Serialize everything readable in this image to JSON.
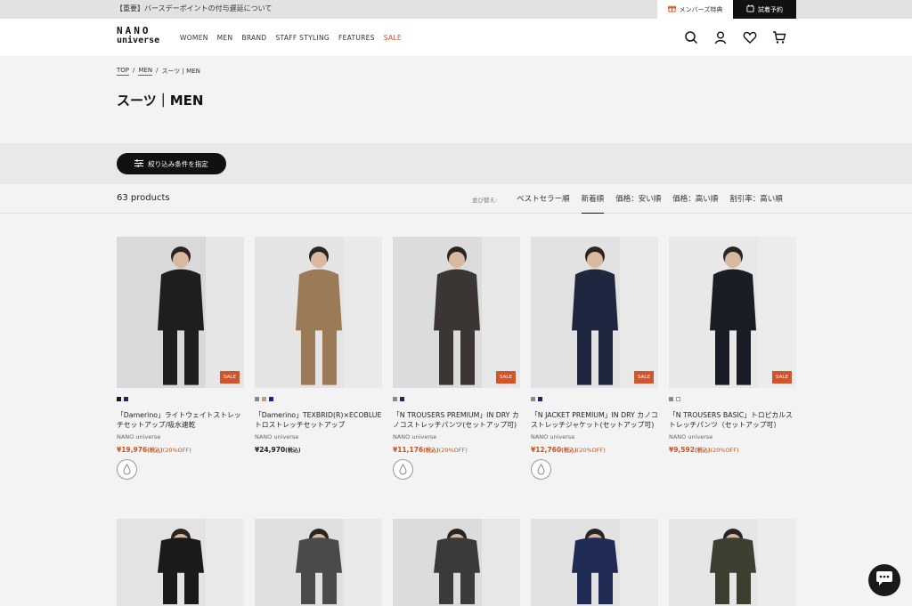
{
  "topbar": {
    "notice": "【重要】バースデーポイントの付与遅延について",
    "member_label": "メンバーズ特典",
    "reserve_label": "試着予約"
  },
  "header": {
    "logo_line1": "NANO",
    "logo_line2": "universe",
    "nav": [
      "WOMEN",
      "MEN",
      "BRAND",
      "STAFF STYLING",
      "FEATURES",
      "SALE"
    ]
  },
  "breadcrumb": [
    "TOP",
    "MEN",
    "スーツ | MEN"
  ],
  "page_title": "スーツ｜MEN",
  "filter_label": "絞り込み条件を指定",
  "product_count": "63 products",
  "sort": {
    "label": "並び替え:",
    "options": [
      "ベストセラー順",
      "新着順",
      "価格：安い順",
      "価格：高い順",
      "割引率：高い順"
    ],
    "active": "新着順"
  },
  "products": [
    {
      "name": "「Damerino」ライトウェイトストレッチセットアップ/吸水速乾",
      "brand": "NANO universe",
      "price": "¥19,976",
      "tax": "(税込)",
      "discount": "(20%OFF)",
      "sale": true,
      "sale_badge": "SALE",
      "swatches": [
        "#1a1a1a",
        "#1c2a5a"
      ],
      "feature_icon": true,
      "photo_colors": {
        "bg": "#d9d9d9",
        "suit": "#1e1e1e"
      }
    },
    {
      "name": "「Damerino」TEXBRID(R)×ECOBLUEトロストレッチセットアップ",
      "brand": "NANO universe",
      "price": "¥24,970",
      "tax": "(税込)",
      "discount": "",
      "sale": false,
      "sale_badge": "",
      "swatches": [
        "#8a8a8a",
        "#b9a184",
        "#1c2a7a"
      ],
      "feature_icon": false,
      "photo_colors": {
        "bg": "#e4e4e4",
        "suit": "#9b7a57"
      }
    },
    {
      "name": "「N TROUSERS PREMIUM」IN DRY カノコストレッチパンツ(セットアップ可)",
      "brand": "NANO universe",
      "price": "¥11,176",
      "tax": "(税込)",
      "discount": "(20%OFF)",
      "sale": true,
      "sale_badge": "SALE",
      "swatches": [
        "#8a8a8a",
        "#1c2a5a"
      ],
      "feature_icon": true,
      "photo_colors": {
        "bg": "#dcdcdc",
        "suit": "#3b3633"
      }
    },
    {
      "name": "「N JACKET PREMIUM」IN DRY カノコストレッチジャケット(セットアップ可)",
      "brand": "NANO universe",
      "price": "¥12,760",
      "tax": "(税込)",
      "discount": "(20%OFF)",
      "sale": true,
      "sale_badge": "SALE",
      "swatches": [
        "#8a8a8a",
        "#1c2a5a"
      ],
      "feature_icon": true,
      "photo_colors": {
        "bg": "#e2e2e2",
        "suit": "#1f2640"
      }
    },
    {
      "name": "「N TROUSERS BASIC」トロピカルストレッチパンツ（セットアップ可）",
      "brand": "NANO universe",
      "price": "¥9,592",
      "tax": "(税込)",
      "discount": "(20%OFF)",
      "sale": true,
      "sale_badge": "SALE",
      "swatches": [
        "#8a8a8a",
        "#ffffff"
      ],
      "feature_icon": false,
      "photo_colors": {
        "bg": "#e8e8e8",
        "suit": "#1a1c26"
      }
    }
  ],
  "second_row_photo_colors": [
    {
      "bg": "#e3e3e3",
      "suit": "#1a1a1a"
    },
    {
      "bg": "#e0e0e0",
      "suit": "#4a4a4a"
    },
    {
      "bg": "#dcdcdc",
      "suit": "#3a3a3a"
    },
    {
      "bg": "#e2e2e2",
      "suit": "#1f2a55"
    },
    {
      "bg": "#e6e6e6",
      "suit": "#3c4030"
    }
  ],
  "colors": {
    "accent_sale": "#c9531e",
    "badge": "#d2552a",
    "dark": "#111111"
  },
  "icons": [
    "gift-icon",
    "calendar-icon",
    "search-icon",
    "user-icon",
    "heart-icon",
    "cart-icon",
    "filter-icon",
    "chat-icon"
  ]
}
